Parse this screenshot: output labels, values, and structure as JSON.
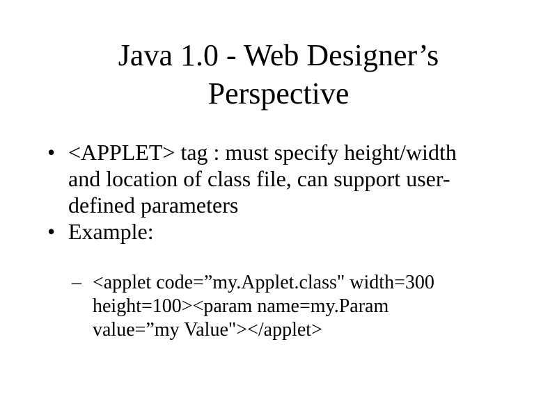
{
  "slide": {
    "title_lines": [
      "Java 1.0 - Web Designer’s",
      "Perspective"
    ],
    "bullets": [
      {
        "marker": "•",
        "lines": [
          "<APPLET> tag : must specify height/width",
          "and location of class file, can support user-",
          "defined parameters"
        ]
      },
      {
        "marker": "•",
        "lines": [
          "Example:"
        ]
      }
    ],
    "sub_bullet": {
      "marker": "–",
      "lines": [
        "<applet code=”my.Applet.class\" width=300",
        "height=100><param name=my.Param",
        "value=”my Value\"></applet>"
      ]
    }
  }
}
